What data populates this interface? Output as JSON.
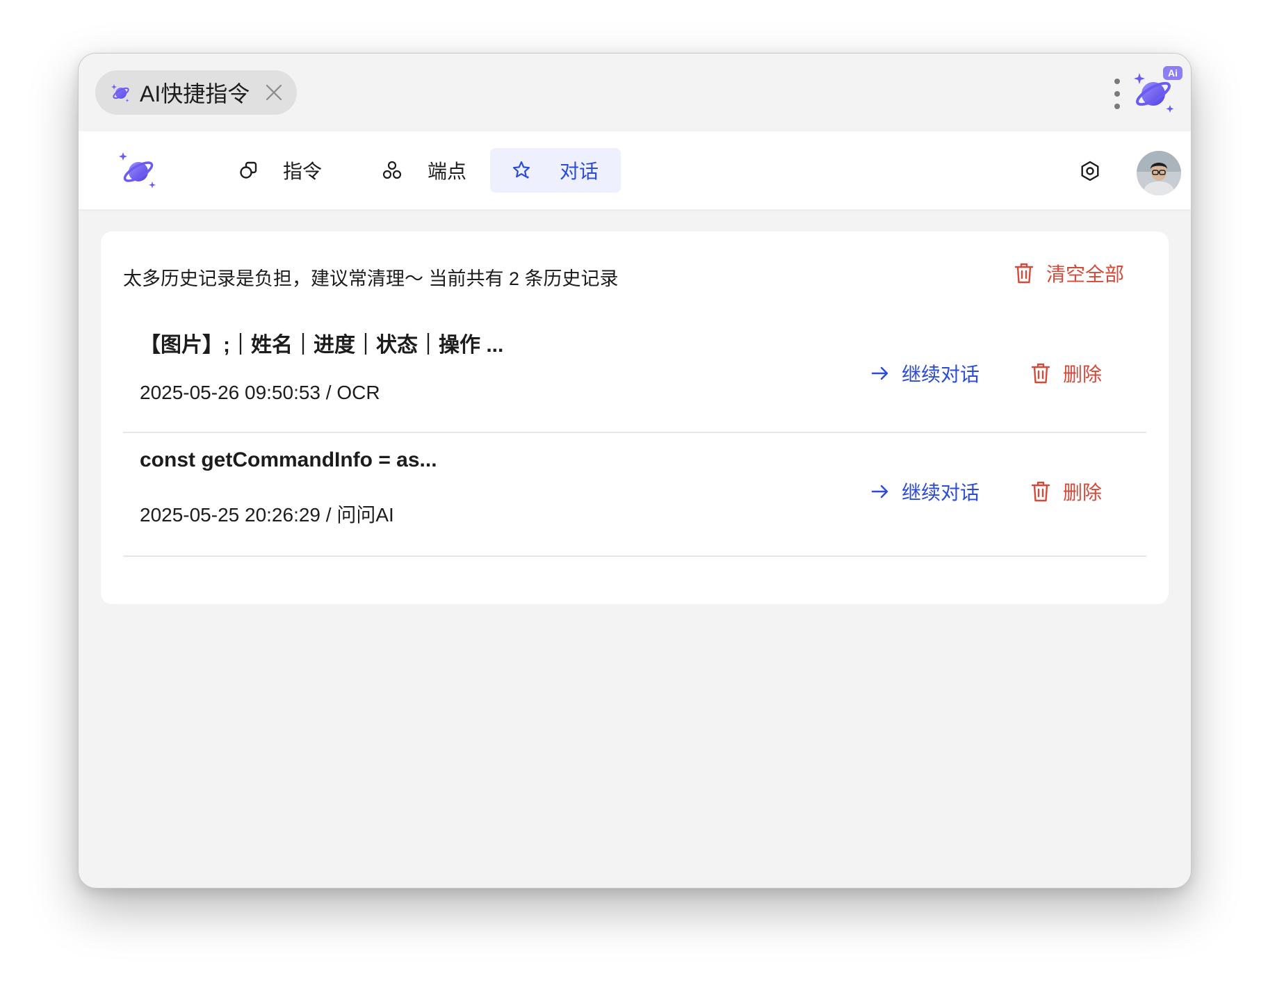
{
  "titlebar": {
    "tab_label": "AI快捷指令",
    "tab_icon": "ai-sparkle-planet-icon",
    "close_icon": "close-icon",
    "menu_icon": "more-vertical-icon",
    "logo_badge": "Ai"
  },
  "nav": {
    "items": [
      {
        "label": "指令",
        "icon": "command-shapes-icon"
      },
      {
        "label": "端点",
        "icon": "nodes-icon"
      },
      {
        "label": "对话",
        "icon": "star-chat-icon",
        "active": true
      }
    ],
    "settings_icon": "settings-hexagon-icon"
  },
  "history": {
    "summary": "太多历史记录是负担，建议常清理～ 当前共有 2 条历史记录",
    "clear_all_label": "清空全部",
    "items": [
      {
        "title": "【图片】;｜姓名｜进度｜状态｜操作 ...",
        "meta": "2025-05-26 09:50:53 / OCR",
        "continue_label": "继续对话",
        "delete_label": "删除"
      },
      {
        "title": "const getCommandInfo = as...",
        "meta": "2025-05-25 20:26:29 / 问问AI",
        "continue_label": "继续对话",
        "delete_label": "删除"
      }
    ]
  },
  "colors": {
    "accent_blue": "#2b4bd6",
    "danger_red": "#d34a3a",
    "logo_purple": "#6a5cf0",
    "active_tab_bg": "#eef1fd"
  }
}
